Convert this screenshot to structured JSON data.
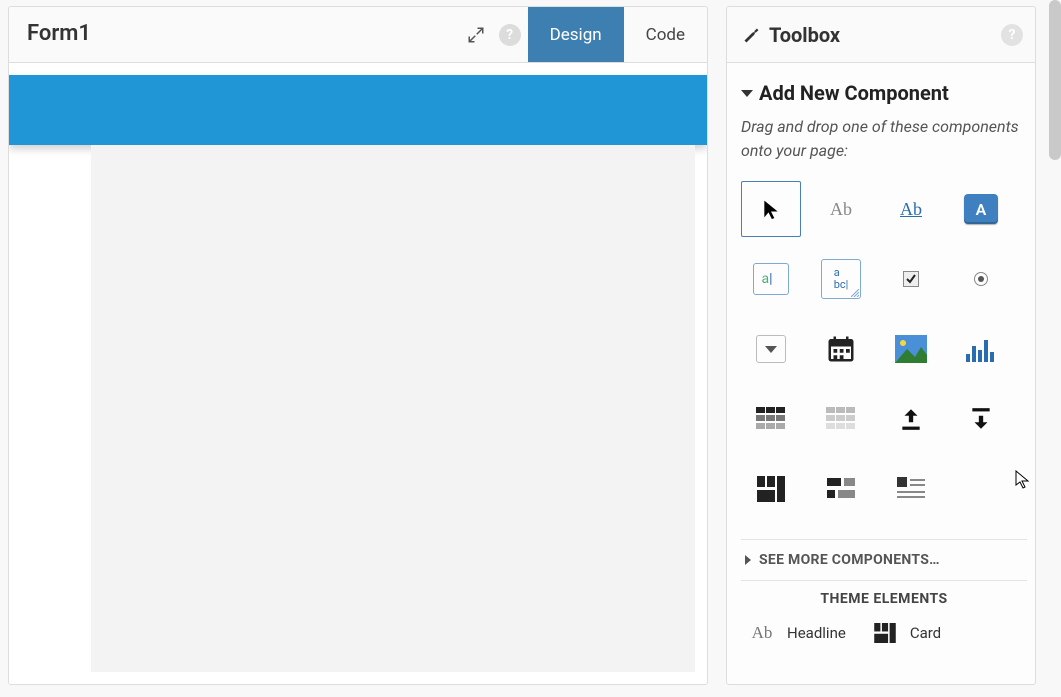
{
  "form": {
    "title": "Form1",
    "tabs": {
      "design": "Design",
      "code": "Code"
    }
  },
  "toolbox": {
    "title": "Toolbox",
    "section_title": "Add New Component",
    "help_text": "Drag and drop one of these components onto your page:",
    "see_more": "SEE MORE COMPONENTS…",
    "theme_header": "THEME ELEMENTS",
    "theme_items": {
      "headline": "Headline",
      "card": "Card"
    },
    "components": [
      {
        "name": "pointer"
      },
      {
        "name": "label"
      },
      {
        "name": "link"
      },
      {
        "name": "button"
      },
      {
        "name": "textbox"
      },
      {
        "name": "textarea"
      },
      {
        "name": "checkbox"
      },
      {
        "name": "radio"
      },
      {
        "name": "dropdown"
      },
      {
        "name": "datepicker"
      },
      {
        "name": "image"
      },
      {
        "name": "plot"
      },
      {
        "name": "data-grid"
      },
      {
        "name": "repeating-panel"
      },
      {
        "name": "file-upload"
      },
      {
        "name": "file-download"
      },
      {
        "name": "column-panel"
      },
      {
        "name": "flow-panel"
      },
      {
        "name": "rich-text"
      }
    ]
  }
}
